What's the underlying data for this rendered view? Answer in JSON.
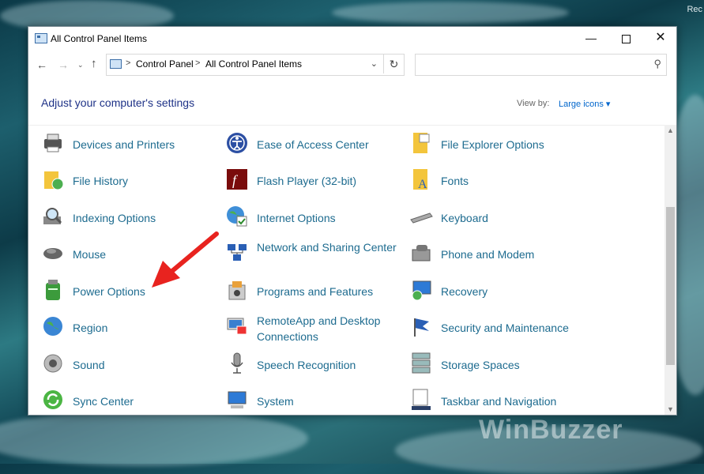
{
  "desktop": {
    "corner_text": "Rec",
    "watermark": "WinBuzzer"
  },
  "window": {
    "title": "All Control Panel Items",
    "controls": {
      "minimize": "—",
      "maximize": "",
      "close": "✕"
    }
  },
  "nav": {
    "back": "←",
    "forward": "→",
    "recent": "⌄",
    "up": "↑",
    "breadcrumb": [
      "Control Panel",
      "All Control Panel Items"
    ],
    "separator": ">",
    "dropdown": "⌄",
    "refresh": "↻",
    "search_placeholder": ""
  },
  "header": {
    "title": "Adjust your computer's settings",
    "view_by_label": "View by:",
    "view_by_value": "Large icons ▾"
  },
  "items": [
    {
      "label": "Devices and Printers",
      "icon": "printer-icon"
    },
    {
      "label": "Ease of Access Center",
      "icon": "ease-of-access-icon"
    },
    {
      "label": "File Explorer Options",
      "icon": "folder-options-icon"
    },
    {
      "label": "File History",
      "icon": "file-history-icon"
    },
    {
      "label": "Flash Player (32-bit)",
      "icon": "flash-icon"
    },
    {
      "label": "Fonts",
      "icon": "fonts-icon"
    },
    {
      "label": "Indexing Options",
      "icon": "indexing-icon"
    },
    {
      "label": "Internet Options",
      "icon": "internet-options-icon"
    },
    {
      "label": "Keyboard",
      "icon": "keyboard-icon"
    },
    {
      "label": "Mouse",
      "icon": "mouse-icon"
    },
    {
      "label": "Network and Sharing Center",
      "icon": "network-icon"
    },
    {
      "label": "Phone and Modem",
      "icon": "phone-icon"
    },
    {
      "label": "Power Options",
      "icon": "power-icon"
    },
    {
      "label": "Programs and Features",
      "icon": "programs-icon"
    },
    {
      "label": "Recovery",
      "icon": "recovery-icon"
    },
    {
      "label": "Region",
      "icon": "region-icon"
    },
    {
      "label": "RemoteApp and Desktop Connections",
      "icon": "remoteapp-icon"
    },
    {
      "label": "Security and Maintenance",
      "icon": "security-flag-icon"
    },
    {
      "label": "Sound",
      "icon": "sound-icon"
    },
    {
      "label": "Speech Recognition",
      "icon": "microphone-icon"
    },
    {
      "label": "Storage Spaces",
      "icon": "storage-icon"
    },
    {
      "label": "Sync Center",
      "icon": "sync-icon"
    },
    {
      "label": "System",
      "icon": "system-icon"
    },
    {
      "label": "Taskbar and Navigation",
      "icon": "taskbar-icon"
    }
  ],
  "colors": {
    "link": "#1d6b8f",
    "title": "#1e3287",
    "arrow": "#e8231f"
  }
}
